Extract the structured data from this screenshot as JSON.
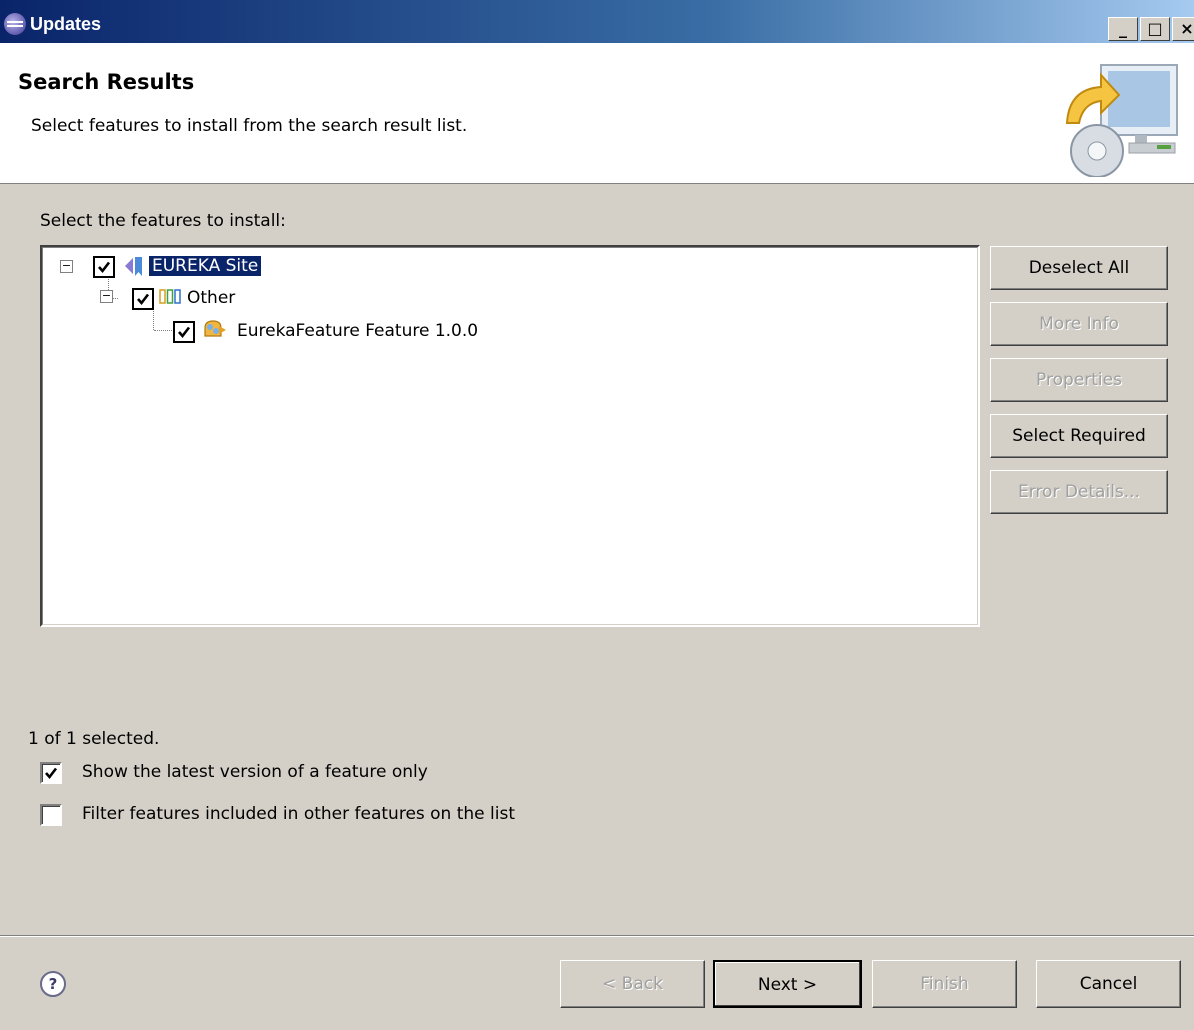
{
  "window": {
    "title": "Updates",
    "controls": [
      "_",
      "□",
      "×"
    ]
  },
  "header": {
    "title": "Search Results",
    "description": "Select features to install from the search result list."
  },
  "tree": {
    "label": "Select the features to install:",
    "label_mnemonic": "i",
    "nodes": [
      {
        "label": "EUREKA Site",
        "checked": true,
        "expanded": true,
        "selected": true,
        "icon": "update-site-icon"
      },
      {
        "label": "Other",
        "checked": true,
        "expanded": true,
        "selected": false,
        "icon": "category-icon"
      },
      {
        "label": "EurekaFeature Feature 1.0.0",
        "checked": true,
        "selected": false,
        "icon": "feature-icon"
      }
    ]
  },
  "side_buttons": {
    "deselect_all": "Deselect All",
    "more_info": "More Info",
    "properties": "Properties",
    "select_required": "Select Required",
    "error_details": "Error Details..."
  },
  "status": "1 of 1 selected.",
  "options": {
    "latest_version": {
      "label": "Show the latest version of a feature only",
      "checked": true
    },
    "filter_included": {
      "label": "Filter features included in other features on the list",
      "checked": false
    }
  },
  "footer": {
    "back": "< Back",
    "next": "Next >",
    "finish": "Finish",
    "cancel": "Cancel",
    "help": "?"
  }
}
